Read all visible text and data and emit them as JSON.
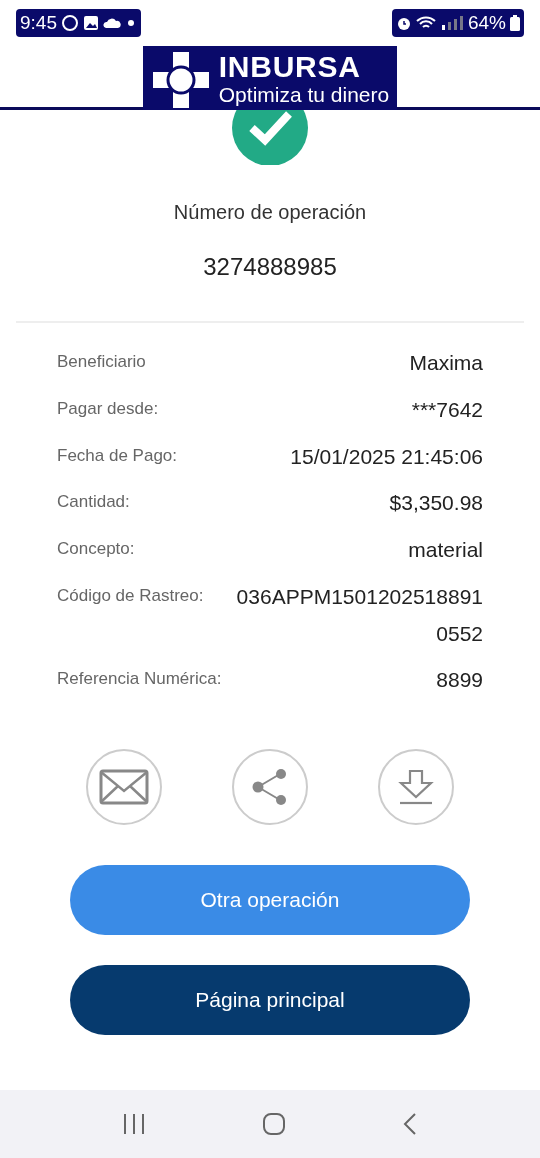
{
  "status_bar": {
    "time": "9:45",
    "battery": "64%"
  },
  "header": {
    "brand": "INBURSA",
    "slogan": "Optimiza tu dinero"
  },
  "operation": {
    "label": "Número de operación",
    "number": "3274888985"
  },
  "details": [
    {
      "label": "Beneficiario",
      "value": "Maxima"
    },
    {
      "label": "Pagar desde:",
      "value": "***7642"
    },
    {
      "label": "Fecha de Pago:",
      "value": "15/01/2025 21:45:06"
    },
    {
      "label": "Cantidad:",
      "value": "$3,350.98"
    },
    {
      "label": "Concepto:",
      "value": "material"
    },
    {
      "label": "Código de Rastreo:",
      "value": "036APPM1501202518891 0552"
    },
    {
      "label": "Referencia Numérica:",
      "value": "8899"
    }
  ],
  "actions": [
    {
      "kind": "email"
    },
    {
      "kind": "share"
    },
    {
      "kind": "download"
    }
  ],
  "buttons": [
    {
      "label": "Otra operación",
      "kind": "secondary"
    },
    {
      "label": "Página principal",
      "kind": "primary"
    }
  ]
}
